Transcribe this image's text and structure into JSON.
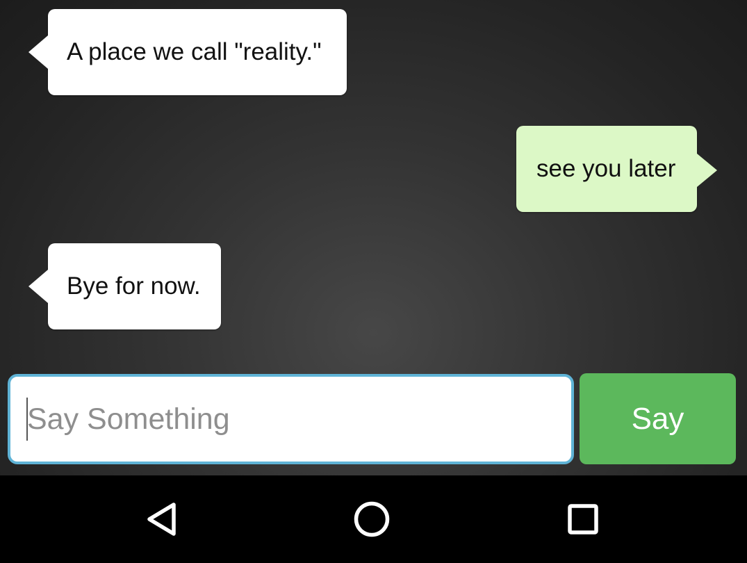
{
  "messages": [
    {
      "direction": "incoming",
      "text": "A place we call \"reality.\""
    },
    {
      "direction": "outgoing",
      "text": "see you later"
    },
    {
      "direction": "incoming",
      "text": "Bye for now."
    }
  ],
  "composer": {
    "placeholder": "Say Something",
    "value": "",
    "send_label": "Say"
  },
  "nav": {
    "back_icon": "back-triangle-icon",
    "home_icon": "home-circle-icon",
    "recents_icon": "recents-square-icon"
  },
  "colors": {
    "incoming_bubble": "#ffffff",
    "outgoing_bubble": "#dcf8c6",
    "send_button": "#5cb85c",
    "input_border": "#5fb3d6",
    "nav_bar": "#000000"
  }
}
